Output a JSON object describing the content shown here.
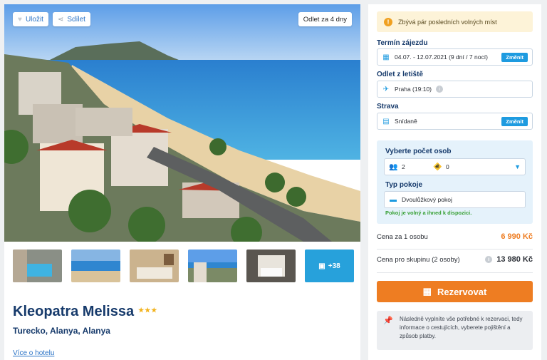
{
  "hero": {
    "save_label": "Uložit",
    "share_label": "Sdílet",
    "departure_badge": "Odlet za 4 dny"
  },
  "gallery": {
    "more_count": "+38"
  },
  "hotel": {
    "name": "Kleopatra Melissa",
    "stars": "★★★",
    "location": "Turecko, Alanya, Alanya",
    "more_link": "Více o hotelu"
  },
  "booking": {
    "alert": "Zbývá pár posledních volných míst",
    "term_label": "Termín zájezdu",
    "term_value": "04.07. - 12.07.2021 (9 dní / 7 nocí)",
    "change_label": "Změnit",
    "airport_label": "Odlet z letiště",
    "airport_value": "Praha (19:10)",
    "board_label": "Strava",
    "board_value": "Snídaně",
    "persons_label": "Vyberte počet osob",
    "adults": "2",
    "children": "0",
    "room_label": "Typ pokoje",
    "room_value": "Dvoulůžkový pokoj",
    "room_note": "Pokoj je volný a ihned k dispozici.",
    "price_per_person_label": "Cena za 1 osobu",
    "price_per_person": "6 990 Kč",
    "price_group_label": "Cena pro skupinu (2 osoby)",
    "price_group": "13 980 Kč",
    "reserve_label": "Rezervovat",
    "footer_note": "Následně vyplníte vše potřebné k rezervaci, tedy informace o cestujících, vyberete pojištění a způsob platby."
  },
  "colors": {
    "accent_blue": "#1e9be0",
    "orange": "#ee7d22",
    "navy": "#163a6b",
    "green": "#38a035"
  }
}
